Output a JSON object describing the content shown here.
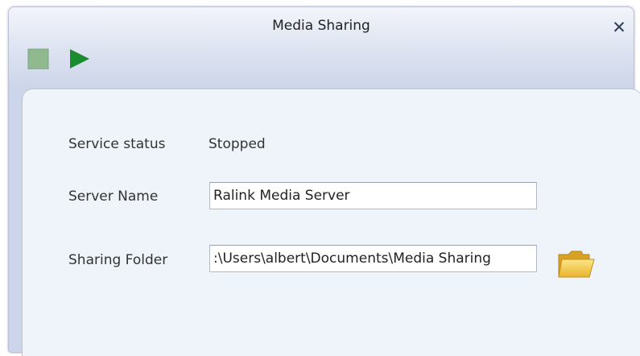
{
  "window": {
    "title": "Media Sharing"
  },
  "toolbar": {
    "stop_icon": "stop-icon",
    "play_icon": "play-icon"
  },
  "form": {
    "service_status_label": "Service status",
    "service_status_value": "Stopped",
    "server_name_label": "Server Name",
    "server_name_value": "Ralink Media Server",
    "sharing_folder_label": "Sharing Folder",
    "sharing_folder_value": ":\\Users\\albert\\Documents\\Media Sharing",
    "folder_icon": "folder-icon"
  },
  "colors": {
    "stop": "#8fb98f",
    "play": "#1a8b2f",
    "folder": "#f2c94c"
  }
}
